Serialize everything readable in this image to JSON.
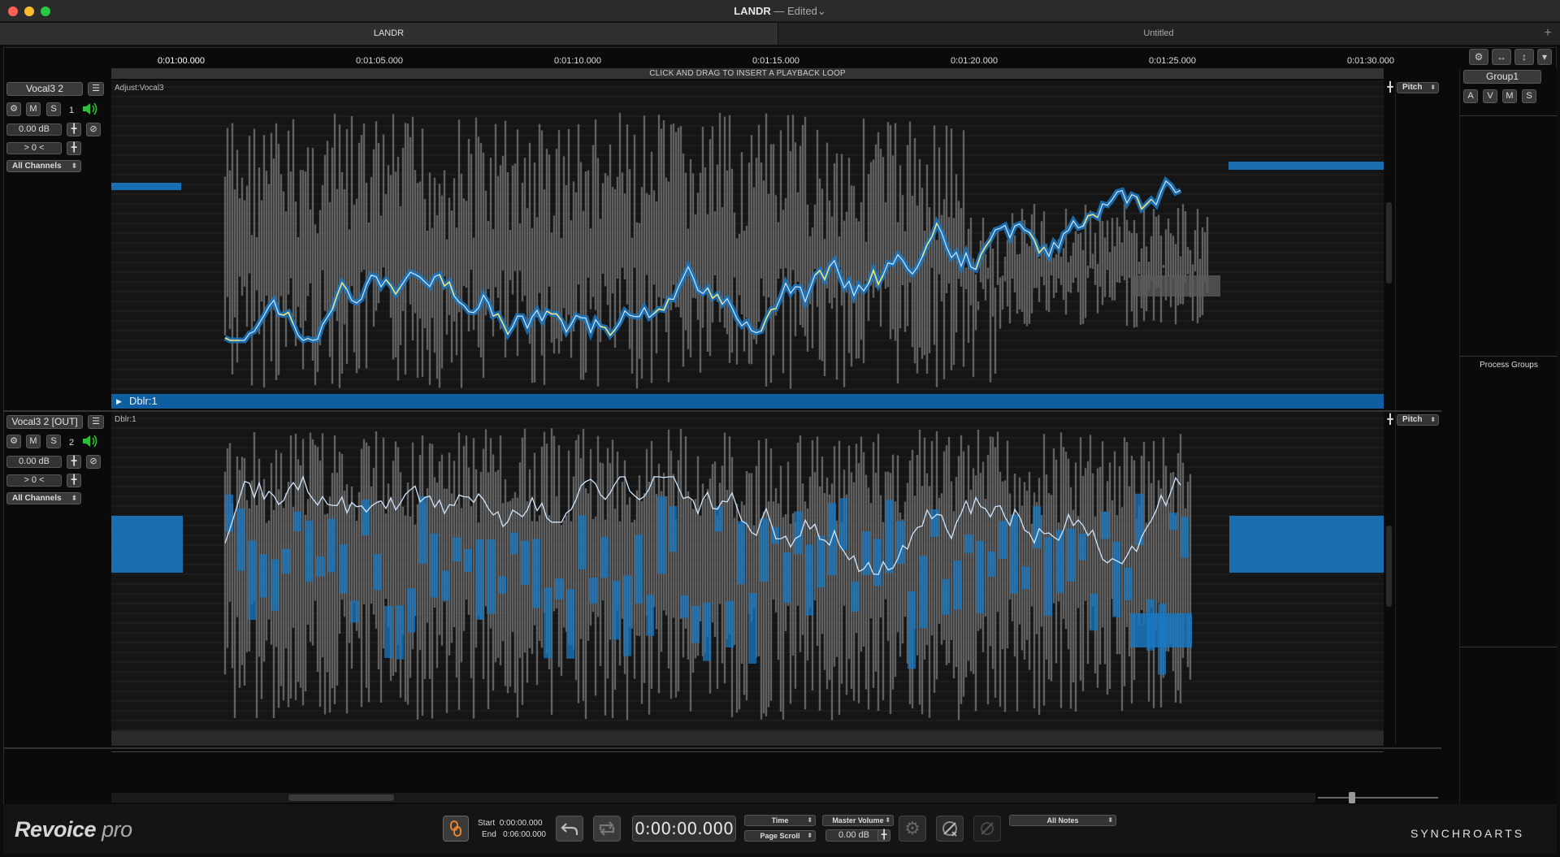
{
  "window": {
    "title": "LANDR",
    "separator": "—",
    "status": "Edited",
    "status_chevron": "⌄"
  },
  "tabs": [
    {
      "label": "LANDR",
      "active": true
    },
    {
      "label": "Untitled",
      "active": false
    }
  ],
  "tab_add_label": "+",
  "ruler": {
    "labels": [
      "0:01:00.000",
      "0:01:05.000",
      "0:01:10.000",
      "0:01:15.000",
      "0:01:20.000",
      "0:01:25.000",
      "0:01:30.000"
    ]
  },
  "loop_bar_text": "CLICK AND DRAG TO INSERT A PLAYBACK LOOP",
  "tracks": [
    {
      "name": "Vocal3 2",
      "number": "1",
      "mute": "M",
      "solo": "S",
      "gain": "0.00 dB",
      "pan": "> 0 <",
      "channels": "All Channels",
      "lane_label": "Adjust:Vocal3",
      "view_mode": "Pitch"
    },
    {
      "name": "Vocal3 2 [OUT]",
      "number": "2",
      "mute": "M",
      "solo": "S",
      "gain": "0.00 dB",
      "pan": "> 0 <",
      "channels": "All Channels",
      "lane_label": "Dblr:1",
      "view_mode": "Pitch"
    }
  ],
  "process_bar_label": "Dblr:1",
  "group_panel": {
    "group_name": "Group1",
    "buttons": [
      "A",
      "V",
      "M",
      "S"
    ],
    "process_groups_label": "Process Groups"
  },
  "transport": {
    "start_label": "Start",
    "start_value": "0:00:00.000",
    "end_label": "End",
    "end_value": "0:06:00.000",
    "timecode": "0:00:00.000",
    "time_mode": "Time",
    "scroll_mode": "Page Scroll",
    "master_volume_label": "Master Volume",
    "master_volume_value": "0.00 dB",
    "notes_filter": "All Notes"
  },
  "branding": {
    "logo_main": "Revoice",
    "logo_suffix": "pro",
    "company": "SYNCHROARTS"
  },
  "colors": {
    "accent_blue": "#1a78c2",
    "pitch_yellow": "#f2e27a",
    "waveform_gray": "#7a7a7a",
    "speaker_green": "#2fbf3a",
    "link_orange": "#e9832a"
  }
}
